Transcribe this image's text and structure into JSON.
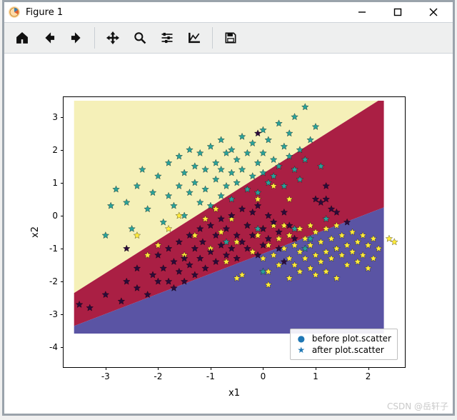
{
  "window": {
    "title": "Figure 1"
  },
  "toolbar": {
    "home": "Home",
    "back": "Back",
    "forward": "Forward",
    "pan": "Pan",
    "zoom": "Zoom",
    "subplots": "Configure subplots",
    "edit": "Edit axis",
    "save": "Save"
  },
  "watermark": "CSDN @岳轩子",
  "chart_data": {
    "type": "scatter",
    "xlabel": "x1",
    "ylabel": "x2",
    "xlim": [
      -3.8,
      2.7
    ],
    "ylim": [
      -4.6,
      3.6
    ],
    "xticks": [
      -3,
      -2,
      -1,
      0,
      1,
      2
    ],
    "yticks": [
      -4,
      -3,
      -2,
      -1,
      0,
      1,
      2,
      3
    ],
    "legend": [
      "before plot.scatter",
      "after plot.scatter"
    ],
    "regions": [
      {
        "name": "top-left",
        "color": "#f5f0b8",
        "vertices": [
          [
            -3.6,
            3.6
          ],
          [
            2.3,
            3.6
          ],
          [
            -3.6,
            -2.35
          ]
        ]
      },
      {
        "name": "middle",
        "color": "#aa1f44",
        "vertices": [
          [
            -3.6,
            -2.35
          ],
          [
            2.3,
            3.6
          ],
          [
            2.3,
            0.25
          ],
          [
            -3.6,
            -3.35
          ]
        ]
      },
      {
        "name": "bottom-right",
        "color": "#5a54a4",
        "vertices": [
          [
            -3.6,
            -3.35
          ],
          [
            2.3,
            0.25
          ],
          [
            2.3,
            -4.6
          ],
          [
            -3.6,
            -4.6
          ]
        ]
      }
    ],
    "series": [
      {
        "name": "cluster-teal",
        "color": "#2aa198",
        "marker": "star",
        "points": [
          [
            -3.0,
            -0.6
          ],
          [
            -2.9,
            0.3
          ],
          [
            -2.8,
            0.8
          ],
          [
            -2.6,
            0.4
          ],
          [
            -2.5,
            -0.4
          ],
          [
            -2.4,
            0.9
          ],
          [
            -2.3,
            1.4
          ],
          [
            -2.2,
            0.2
          ],
          [
            -2.1,
            0.7
          ],
          [
            -2.0,
            1.2
          ],
          [
            -1.9,
            -0.2
          ],
          [
            -1.8,
            1.6
          ],
          [
            -1.8,
            0.6
          ],
          [
            -1.7,
            0.3
          ],
          [
            -1.6,
            1.8
          ],
          [
            -1.6,
            0.9
          ],
          [
            -1.5,
            1.3
          ],
          [
            -1.5,
            0.0
          ],
          [
            -1.4,
            2.0
          ],
          [
            -1.4,
            0.7
          ],
          [
            -1.3,
            1.5
          ],
          [
            -1.3,
            1.0
          ],
          [
            -1.2,
            0.4
          ],
          [
            -1.2,
            1.9
          ],
          [
            -1.1,
            0.8
          ],
          [
            -1.1,
            1.4
          ],
          [
            -1.0,
            2.1
          ],
          [
            -1.0,
            0.3
          ],
          [
            -0.9,
            1.6
          ],
          [
            -0.9,
            1.1
          ],
          [
            -0.8,
            2.3
          ],
          [
            -0.8,
            0.6
          ],
          [
            -0.8,
            1.4
          ],
          [
            -0.7,
            1.9
          ],
          [
            -0.7,
            0.9
          ],
          [
            -0.6,
            1.3
          ],
          [
            -0.6,
            2.0
          ],
          [
            -0.6,
            0.5
          ],
          [
            -0.5,
            1.7
          ],
          [
            -0.5,
            1.0
          ],
          [
            -0.4,
            2.4
          ],
          [
            -0.4,
            1.4
          ],
          [
            -0.3,
            0.8
          ],
          [
            -0.3,
            1.9
          ],
          [
            -0.2,
            1.2
          ],
          [
            -0.2,
            2.2
          ],
          [
            -0.1,
            1.6
          ],
          [
            -0.1,
            0.7
          ],
          [
            0.0,
            2.6
          ],
          [
            0.0,
            1.3
          ],
          [
            0.0,
            1.9
          ],
          [
            0.1,
            1.0
          ],
          [
            0.1,
            2.3
          ],
          [
            0.2,
            1.7
          ],
          [
            0.2,
            1.2
          ],
          [
            0.3,
            2.8
          ],
          [
            0.3,
            1.5
          ],
          [
            0.4,
            2.1
          ],
          [
            0.4,
            0.9
          ],
          [
            0.5,
            1.8
          ],
          [
            0.5,
            2.5
          ],
          [
            0.6,
            1.4
          ],
          [
            0.6,
            3.0
          ],
          [
            0.7,
            2.0
          ],
          [
            0.7,
            1.1
          ],
          [
            0.8,
            3.3
          ],
          [
            0.8,
            1.7
          ],
          [
            0.9,
            2.3
          ],
          [
            1.0,
            2.7
          ],
          [
            1.1,
            1.5
          ],
          [
            1.2,
            -0.1
          ],
          [
            1.4,
            -1.0
          ],
          [
            0.6,
            -0.4
          ],
          [
            0.9,
            -0.7
          ],
          [
            -0.7,
            -0.8
          ],
          [
            -0.1,
            -0.4
          ],
          [
            -0.0,
            -1.7
          ],
          [
            0.8,
            -1.0
          ]
        ]
      },
      {
        "name": "cluster-yellow",
        "color": "#ffeb3b",
        "marker": "star",
        "points": [
          [
            -2.4,
            -0.6
          ],
          [
            -2.2,
            -1.2
          ],
          [
            -2.0,
            -0.9
          ],
          [
            -1.8,
            -0.4
          ],
          [
            -1.6,
            0.0
          ],
          [
            -1.5,
            -1.2
          ],
          [
            -1.3,
            -0.6
          ],
          [
            -1.1,
            -0.1
          ],
          [
            -1.0,
            -1.0
          ],
          [
            -0.9,
            0.2
          ],
          [
            -0.8,
            -0.5
          ],
          [
            -0.7,
            -1.4
          ],
          [
            -0.6,
            -0.1
          ],
          [
            -0.5,
            -0.8
          ],
          [
            -0.4,
            -1.8
          ],
          [
            -0.3,
            -0.3
          ],
          [
            -0.2,
            -1.1
          ],
          [
            -0.1,
            -0.6
          ],
          [
            0.0,
            -1.3
          ],
          [
            0.0,
            -0.4
          ],
          [
            0.1,
            -1.7
          ],
          [
            0.1,
            -0.9
          ],
          [
            0.2,
            -0.3
          ],
          [
            0.2,
            -1.2
          ],
          [
            0.3,
            -0.7
          ],
          [
            0.3,
            -1.5
          ],
          [
            0.4,
            -1.0
          ],
          [
            0.4,
            -0.3
          ],
          [
            0.5,
            -1.3
          ],
          [
            0.5,
            -0.6
          ],
          [
            0.5,
            -1.9
          ],
          [
            0.6,
            -0.9
          ],
          [
            0.6,
            -1.5
          ],
          [
            0.7,
            -0.4
          ],
          [
            0.7,
            -1.1
          ],
          [
            0.7,
            -1.7
          ],
          [
            0.8,
            -0.7
          ],
          [
            0.8,
            -1.3
          ],
          [
            0.9,
            -0.3
          ],
          [
            0.9,
            -1.6
          ],
          [
            0.9,
            -0.9
          ],
          [
            1.0,
            -1.2
          ],
          [
            1.0,
            -0.5
          ],
          [
            1.0,
            -1.8
          ],
          [
            1.1,
            -0.8
          ],
          [
            1.1,
            -1.4
          ],
          [
            1.2,
            -0.4
          ],
          [
            1.2,
            -1.1
          ],
          [
            1.2,
            -1.7
          ],
          [
            1.3,
            -0.7
          ],
          [
            1.3,
            -1.3
          ],
          [
            1.4,
            -1.0
          ],
          [
            1.4,
            -0.3
          ],
          [
            1.4,
            -1.9
          ],
          [
            1.5,
            -0.6
          ],
          [
            1.5,
            -1.2
          ],
          [
            1.6,
            -0.9
          ],
          [
            1.6,
            -1.5
          ],
          [
            1.7,
            -0.5
          ],
          [
            1.7,
            -1.1
          ],
          [
            1.8,
            -0.8
          ],
          [
            1.8,
            -1.4
          ],
          [
            1.9,
            -0.6
          ],
          [
            1.9,
            -1.2
          ],
          [
            2.0,
            -0.9
          ],
          [
            2.0,
            -1.6
          ],
          [
            2.1,
            -0.7
          ],
          [
            2.1,
            -1.3
          ],
          [
            2.2,
            -1.0
          ],
          [
            2.4,
            -0.7
          ],
          [
            2.5,
            -0.8
          ],
          [
            -0.1,
            0.5
          ],
          [
            0.2,
            0.9
          ],
          [
            0.5,
            0.5
          ],
          [
            -0.5,
            -1.9
          ],
          [
            0.1,
            -2.1
          ]
        ]
      },
      {
        "name": "cluster-dark",
        "color": "#2b0b3a",
        "marker": "star",
        "points": [
          [
            -3.5,
            -2.7
          ],
          [
            -3.3,
            -2.8
          ],
          [
            -3.0,
            -2.4
          ],
          [
            -2.7,
            -2.6
          ],
          [
            -2.6,
            -2.0
          ],
          [
            -2.4,
            -2.2
          ],
          [
            -2.4,
            -1.6
          ],
          [
            -2.2,
            -2.4
          ],
          [
            -2.1,
            -1.8
          ],
          [
            -2.0,
            -2.0
          ],
          [
            -2.0,
            -1.2
          ],
          [
            -1.9,
            -1.6
          ],
          [
            -1.8,
            -2.0
          ],
          [
            -1.8,
            -1.0
          ],
          [
            -1.7,
            -1.4
          ],
          [
            -1.7,
            -2.2
          ],
          [
            -1.6,
            -0.8
          ],
          [
            -1.6,
            -1.7
          ],
          [
            -1.5,
            -1.3
          ],
          [
            -1.5,
            -2.0
          ],
          [
            -1.4,
            -0.6
          ],
          [
            -1.4,
            -1.5
          ],
          [
            -1.3,
            -1.0
          ],
          [
            -1.3,
            -1.8
          ],
          [
            -1.2,
            -0.4
          ],
          [
            -1.2,
            -1.3
          ],
          [
            -1.15,
            -0.8
          ],
          [
            -1.1,
            -1.6
          ],
          [
            -1.0,
            -0.3
          ],
          [
            -1.0,
            -1.1
          ],
          [
            -0.9,
            -0.6
          ],
          [
            -0.9,
            -1.4
          ],
          [
            -0.8,
            -0.1
          ],
          [
            -0.8,
            -0.9
          ],
          [
            -0.7,
            -1.2
          ],
          [
            -0.7,
            -0.4
          ],
          [
            -0.6,
            -1.0
          ],
          [
            -0.6,
            0.0
          ],
          [
            -0.5,
            -0.6
          ],
          [
            -0.5,
            -1.3
          ],
          [
            -0.4,
            0.2
          ],
          [
            -0.4,
            -0.8
          ],
          [
            -0.3,
            -0.3
          ],
          [
            -0.3,
            -1.0
          ],
          [
            -0.2,
            0.1
          ],
          [
            -0.2,
            -0.6
          ],
          [
            -0.1,
            -1.2
          ],
          [
            -0.1,
            0.3
          ],
          [
            0.0,
            -0.4
          ],
          [
            0.0,
            -0.9
          ],
          [
            0.1,
            0.0
          ],
          [
            0.1,
            -0.7
          ],
          [
            0.2,
            -0.2
          ],
          [
            0.3,
            -0.5
          ],
          [
            0.3,
            -1.0
          ],
          [
            0.4,
            0.1
          ],
          [
            0.4,
            -1.4
          ],
          [
            0.5,
            -0.3
          ],
          [
            0.6,
            -0.7
          ],
          [
            1.0,
            0.5
          ],
          [
            1.1,
            0.4
          ],
          [
            1.2,
            0.5
          ],
          [
            1.3,
            0.2
          ],
          [
            1.4,
            0.1
          ],
          [
            1.2,
            0.9
          ],
          [
            1.6,
            -0.2
          ],
          [
            -2.6,
            -1.0
          ],
          [
            -0.1,
            2.5
          ]
        ]
      }
    ]
  }
}
